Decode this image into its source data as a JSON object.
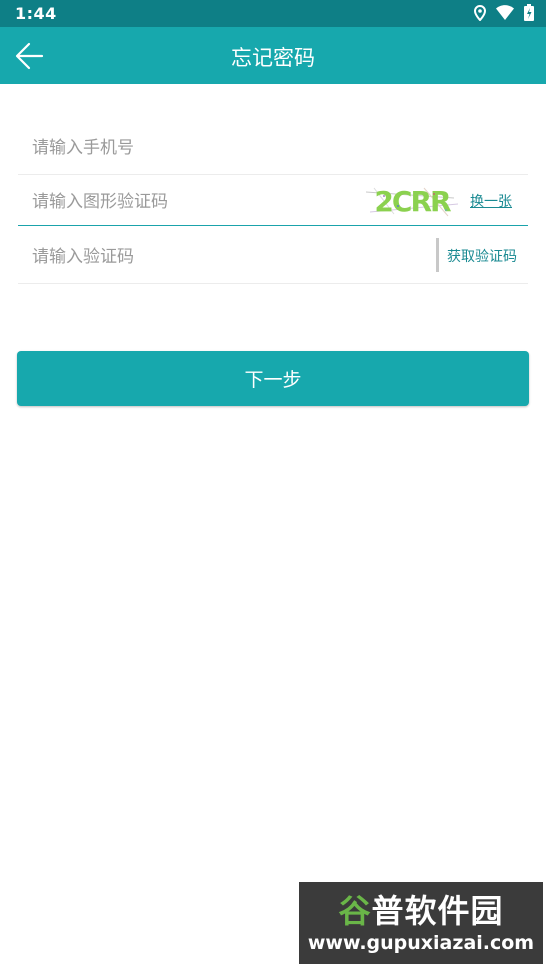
{
  "status_bar": {
    "time": "1:44",
    "icons": [
      "location-icon",
      "wifi-icon",
      "battery-icon"
    ]
  },
  "app_bar": {
    "title": "忘记密码",
    "back_icon": "arrow-left-icon",
    "background": "#17a8ad"
  },
  "form": {
    "phone_placeholder": "请输入手机号",
    "image_code_placeholder": "请输入图形验证码",
    "captcha_text": "2CRR",
    "change_captcha_label": "换一张",
    "sms_code_placeholder": "请输入验证码",
    "get_code_label": "获取验证码"
  },
  "next_button": {
    "label": "下一步"
  },
  "watermark": {
    "title_prefix": "谷",
    "title_rest": "普软件园",
    "url": "www.gupuxiazai.com"
  },
  "colors": {
    "accent": "#17a8ad",
    "status_bar": "#0e7f86",
    "link": "#1a8a92"
  }
}
